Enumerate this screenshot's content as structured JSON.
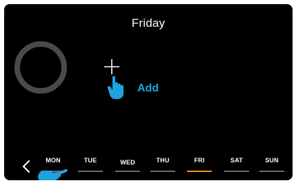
{
  "screen": {
    "title": "Friday"
  },
  "add": {
    "label": "Add"
  },
  "days": [
    {
      "label": "MON",
      "active": false
    },
    {
      "label": "TUE",
      "active": false
    },
    {
      "label": "WED",
      "active": false
    },
    {
      "label": "THU",
      "active": false
    },
    {
      "label": "FRI",
      "active": true
    },
    {
      "label": "SAT",
      "active": false
    },
    {
      "label": "SUN",
      "active": false
    }
  ],
  "colors": {
    "accent_blue": "#1fa3e0",
    "active_day": "#ff9320",
    "inactive_underline": "#6e6e6e",
    "ring": "#4a4a4a",
    "background": "#000000"
  },
  "icons": {
    "ring": "progress-ring-icon",
    "add": "plus-icon",
    "pointer": "pointing-hand-icon",
    "back": "chevron-left-icon"
  }
}
